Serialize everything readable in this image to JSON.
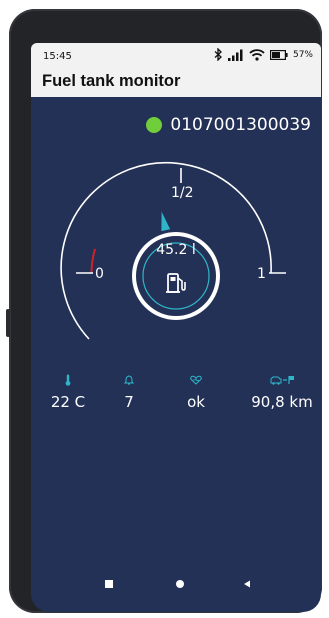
{
  "status": {
    "time": "15:45",
    "battery": "57%"
  },
  "app": {
    "title": "Fuel tank monitor"
  },
  "device": {
    "id": "0107001300039",
    "status_color": "#6fce3a"
  },
  "gauge": {
    "label_empty": "0",
    "label_half": "1/2",
    "label_full": "1",
    "reading": "45.2 l",
    "level_fraction": 0.43
  },
  "stats": {
    "temperature": "22 C",
    "alarms": "7",
    "health": "ok",
    "range": "90,8 km"
  },
  "colors": {
    "accent": "#2fb5c9",
    "background": "#243156",
    "warning": "#d0222a"
  }
}
